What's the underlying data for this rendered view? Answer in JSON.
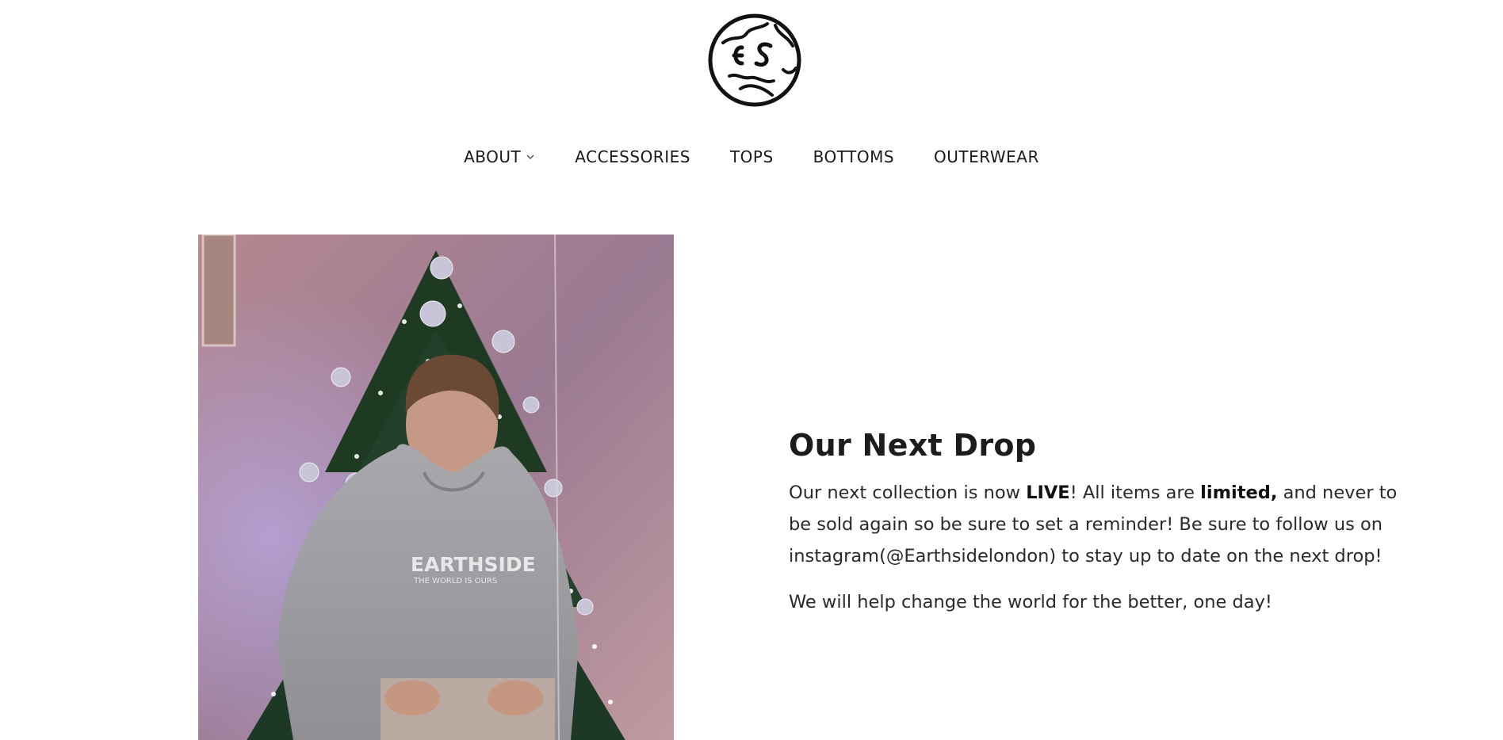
{
  "brand": {
    "logo_icon": "earthside-globe-logo-icon",
    "logo_letters": "ES"
  },
  "nav": {
    "items": [
      {
        "label": "ABOUT",
        "has_dropdown": true
      },
      {
        "label": "ACCESSORIES",
        "has_dropdown": false
      },
      {
        "label": "TOPS",
        "has_dropdown": false
      },
      {
        "label": "BOTTOMS",
        "has_dropdown": false
      },
      {
        "label": "OUTERWEAR",
        "has_dropdown": false
      }
    ]
  },
  "hero": {
    "image_icon": "christmas-tree-hoodie-photo",
    "hoodie_text": "EARTHSIDE",
    "hoodie_subtext": "THE WORLD IS OURS"
  },
  "feature": {
    "title": "Our Next Drop",
    "para1": {
      "t1": "Our next collection is now ",
      "b1": "LIVE",
      "t2": "! All items are ",
      "b2": "limited,",
      "t3": " and never to be sold again so be sure to set a reminder! Be sure to follow us on instagram(@Earthsidelondon) to stay up to date on the next drop!"
    },
    "para2": "We will help change the world for the better, one day!"
  },
  "colors": {
    "text": "#222222",
    "background": "#ffffff"
  }
}
